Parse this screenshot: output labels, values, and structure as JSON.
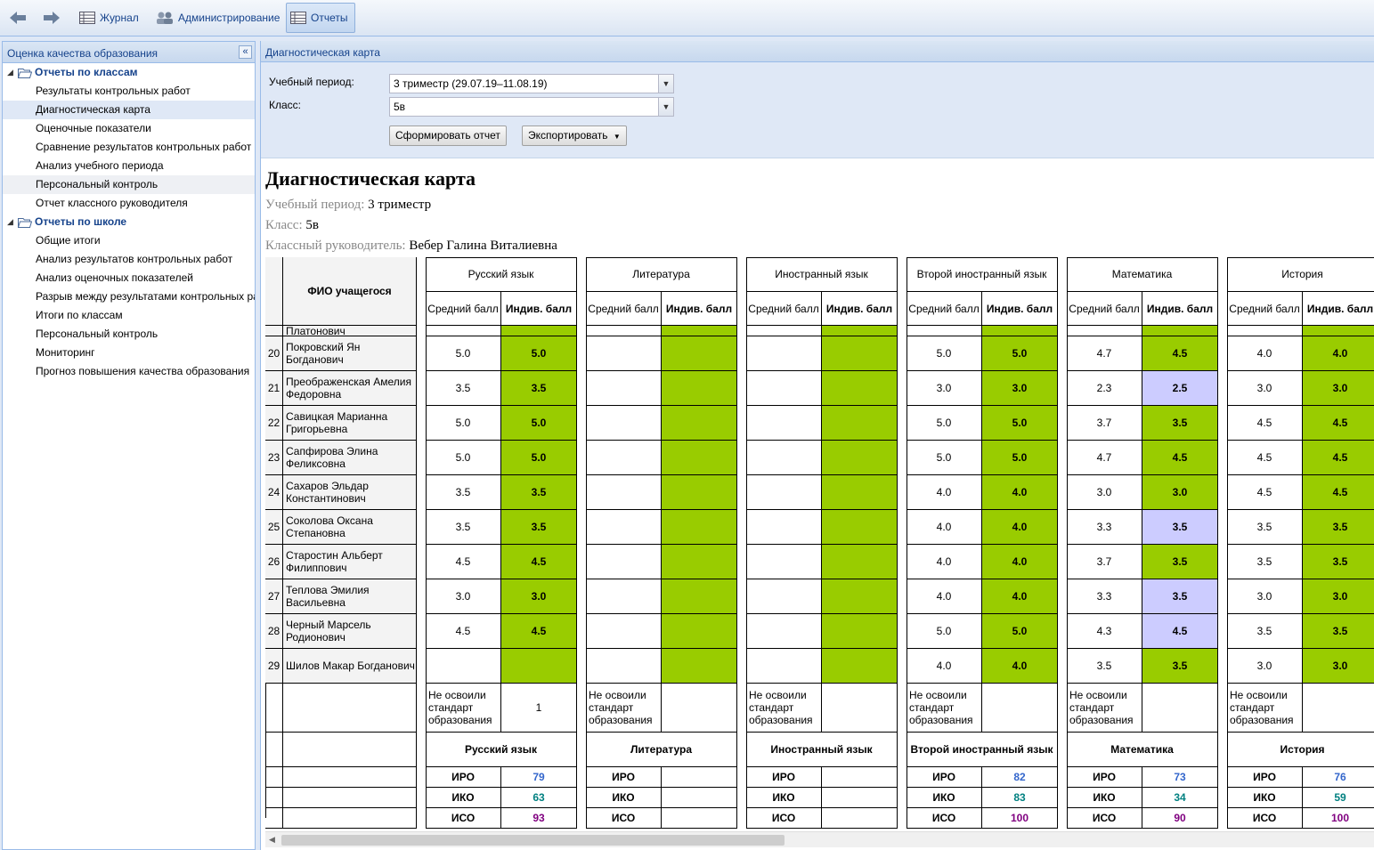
{
  "toolbar": {
    "items": [
      {
        "label": "Журнал",
        "icon": "journal-icon"
      },
      {
        "label": "Администрирование",
        "icon": "users-icon"
      },
      {
        "label": "Отчеты",
        "icon": "reports-icon"
      }
    ]
  },
  "sidebar": {
    "title": "Оценка качества образования",
    "groups": [
      {
        "label": "Отчеты по классам",
        "items": [
          "Результаты контрольных работ",
          "Диагностическая карта",
          "Оценочные показатели",
          "Сравнение результатов контрольных работ",
          "Анализ учебного периода",
          "Персональный контроль",
          "Отчет классного руководителя"
        ]
      },
      {
        "label": "Отчеты по школе",
        "items": [
          "Общие итоги",
          "Анализ результатов контрольных работ",
          "Анализ оценочных показателей",
          "Разрыв между результатами контрольных работ",
          "Итоги по классам",
          "Персональный контроль",
          "Мониторинг",
          "Прогноз повышения качества образования"
        ]
      }
    ]
  },
  "main": {
    "title": "Диагностическая карта",
    "filters": {
      "period_label": "Учебный период:",
      "period_value": "3 триместр (29.07.19–11.08.19)",
      "class_label": "Класс:",
      "class_value": "5в",
      "build_button": "Сформировать отчет",
      "export_button": "Экспортировать"
    },
    "report": {
      "title": "Диагностическая карта",
      "period_label": "Учебный период:",
      "period_value": "3 триместр",
      "class_label": "Класс:",
      "class_value": "5в",
      "teacher_label": "Классный руководитель:",
      "teacher_value": "Вебер Галина Виталиевна",
      "table": {
        "fio_header": "ФИО учащегося",
        "avg_header": "Средний балл",
        "ind_header": "Индив. балл",
        "partial_name": "Платонович",
        "not_mastered": "Не освоили стандарт образования",
        "subjects": [
          "Русский язык",
          "Литература",
          "Иностранный язык",
          "Второй иностранный язык",
          "Математика",
          "История"
        ],
        "rows": [
          {
            "n": "20",
            "name": "Покровский Ян Богданович",
            "scores": [
              [
                "5.0",
                "5.0"
              ],
              [
                "",
                ""
              ],
              [
                "",
                ""
              ],
              [
                "5.0",
                "5.0"
              ],
              [
                "4.7",
                "4.5"
              ],
              [
                "4.0",
                "4.0"
              ]
            ]
          },
          {
            "n": "21",
            "name": "Преображенская Амелия Федоровна",
            "scores": [
              [
                "3.5",
                "3.5"
              ],
              [
                "",
                ""
              ],
              [
                "",
                ""
              ],
              [
                "3.0",
                "3.0"
              ],
              [
                "2.3",
                "2.5"
              ],
              [
                "3.0",
                "3.0"
              ]
            ]
          },
          {
            "n": "22",
            "name": "Савицкая Марианна Григорьевна",
            "scores": [
              [
                "5.0",
                "5.0"
              ],
              [
                "",
                ""
              ],
              [
                "",
                ""
              ],
              [
                "5.0",
                "5.0"
              ],
              [
                "3.7",
                "3.5"
              ],
              [
                "4.5",
                "4.5"
              ]
            ]
          },
          {
            "n": "23",
            "name": "Сапфирова Элина Феликсовна",
            "scores": [
              [
                "5.0",
                "5.0"
              ],
              [
                "",
                ""
              ],
              [
                "",
                ""
              ],
              [
                "5.0",
                "5.0"
              ],
              [
                "4.7",
                "4.5"
              ],
              [
                "4.5",
                "4.5"
              ]
            ]
          },
          {
            "n": "24",
            "name": "Сахаров Эльдар Константинович",
            "scores": [
              [
                "3.5",
                "3.5"
              ],
              [
                "",
                ""
              ],
              [
                "",
                ""
              ],
              [
                "4.0",
                "4.0"
              ],
              [
                "3.0",
                "3.0"
              ],
              [
                "4.5",
                "4.5"
              ]
            ]
          },
          {
            "n": "25",
            "name": "Соколова Оксана Степановна",
            "scores": [
              [
                "3.5",
                "3.5"
              ],
              [
                "",
                ""
              ],
              [
                "",
                ""
              ],
              [
                "4.0",
                "4.0"
              ],
              [
                "3.3",
                "3.5"
              ],
              [
                "3.5",
                "3.5"
              ]
            ]
          },
          {
            "n": "26",
            "name": "Старостин Альберт Филиппович",
            "scores": [
              [
                "4.5",
                "4.5"
              ],
              [
                "",
                ""
              ],
              [
                "",
                ""
              ],
              [
                "4.0",
                "4.0"
              ],
              [
                "3.7",
                "3.5"
              ],
              [
                "3.5",
                "3.5"
              ]
            ]
          },
          {
            "n": "27",
            "name": "Теплова Эмилия Васильевна",
            "scores": [
              [
                "3.0",
                "3.0"
              ],
              [
                "",
                ""
              ],
              [
                "",
                ""
              ],
              [
                "4.0",
                "4.0"
              ],
              [
                "3.3",
                "3.5"
              ],
              [
                "3.0",
                "3.0"
              ]
            ]
          },
          {
            "n": "28",
            "name": "Черный Марсель Родионович",
            "scores": [
              [
                "4.5",
                "4.5"
              ],
              [
                "",
                ""
              ],
              [
                "",
                ""
              ],
              [
                "5.0",
                "5.0"
              ],
              [
                "4.3",
                "4.5"
              ],
              [
                "3.5",
                "3.5"
              ]
            ]
          },
          {
            "n": "29",
            "name": "Шилов Макар Богданович",
            "scores": [
              [
                "",
                ""
              ],
              [
                "",
                ""
              ],
              [
                "",
                ""
              ],
              [
                "4.0",
                "4.0"
              ],
              [
                "3.5",
                "3.5"
              ],
              [
                "3.0",
                "3.0"
              ]
            ]
          }
        ],
        "not_mastered_values": [
          "1",
          "",
          "",
          "",
          "",
          ""
        ],
        "index_labels": [
          "ИРО",
          "ИКО",
          "ИСО"
        ],
        "index_values": [
          [
            "79",
            "63",
            "93"
          ],
          [
            "",
            "",
            ""
          ],
          [
            "",
            "",
            ""
          ],
          [
            "82",
            "83",
            "100"
          ],
          [
            "73",
            "34",
            "90"
          ],
          [
            "76",
            "59",
            "100"
          ]
        ]
      }
    }
  },
  "colors": {
    "green": "#99cc00",
    "lavender": "#ccccff",
    "iro": "#3366cc",
    "iko": "#008080",
    "iso": "#800080"
  }
}
